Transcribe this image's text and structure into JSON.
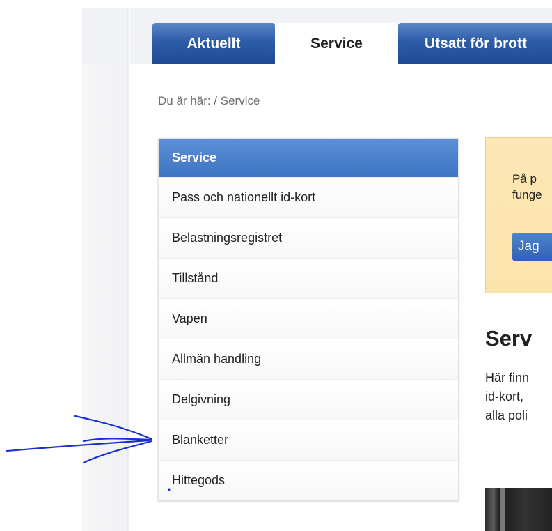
{
  "tabs": [
    {
      "label": "Aktuellt",
      "active": false
    },
    {
      "label": "Service",
      "active": true
    },
    {
      "label": "Utsatt för brott",
      "active": false
    }
  ],
  "breadcrumb": "Du är här: / Service",
  "sidebar": {
    "heading": "Service",
    "items": [
      {
        "label": "Pass och nationellt id-kort"
      },
      {
        "label": "Belastningsregistret"
      },
      {
        "label": "Tillstånd"
      },
      {
        "label": "Vapen"
      },
      {
        "label": "Allmän handling"
      },
      {
        "label": "Delgivning"
      },
      {
        "label": "Blanketter"
      },
      {
        "label": "Hittegods"
      }
    ]
  },
  "notice": {
    "line1": "På p",
    "line2": "funge",
    "button_label": "Jag"
  },
  "main": {
    "title": "Serv",
    "intro_lines": [
      "Här finn",
      "id-kort,",
      "alla poli"
    ]
  },
  "annotation": {
    "color": "#1a2fd6",
    "icon": "hand-drawn-arrow-icon"
  },
  "colors": {
    "tab_blue": "#2d5ca8",
    "sidebar_head": "#4a80cc",
    "notice_bg": "#fde7b5"
  }
}
